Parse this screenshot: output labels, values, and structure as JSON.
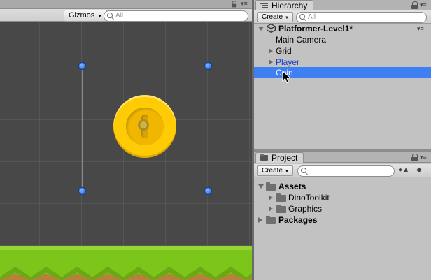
{
  "scene": {
    "gizmos_label": "Gizmos",
    "search_placeholder": "All"
  },
  "hierarchy": {
    "tab_title": "Hierarchy",
    "create_label": "Create",
    "search_placeholder": "All",
    "scene_name": "Platformer-Level1*",
    "items": [
      {
        "label": "Main Camera"
      },
      {
        "label": "Grid"
      },
      {
        "label": "Player"
      },
      {
        "label": "Coin"
      }
    ]
  },
  "project": {
    "tab_title": "Project",
    "create_label": "Create",
    "search_placeholder": "",
    "items": [
      {
        "label": "Assets"
      },
      {
        "label": "DinoToolkit"
      },
      {
        "label": "Graphics"
      },
      {
        "label": "Packages"
      }
    ]
  },
  "colors": {
    "selection": "#3f7ff4",
    "prefab_text": "#1f3fbf",
    "coin": "#ffcb05",
    "ground": "#7cc61b"
  }
}
